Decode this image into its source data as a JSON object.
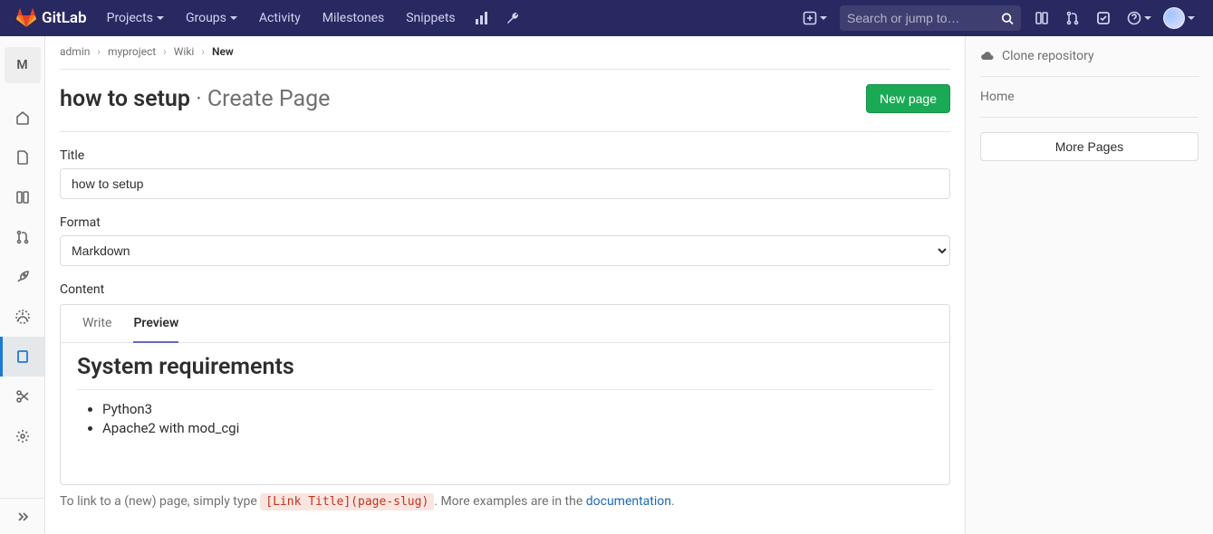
{
  "brand": "GitLab",
  "nav": {
    "projects": "Projects",
    "groups": "Groups",
    "activity": "Activity",
    "milestones": "Milestones",
    "snippets": "Snippets"
  },
  "search": {
    "placeholder": "Search or jump to…"
  },
  "sidenav": {
    "project_initial": "M"
  },
  "breadcrumbs": {
    "a": "admin",
    "b": "myproject",
    "c": "Wiki",
    "d": "New"
  },
  "header": {
    "title": "how to setup",
    "subtitle": " · Create Page",
    "new_page": "New page"
  },
  "form": {
    "title_label": "Title",
    "title_value": "how to setup",
    "format_label": "Format",
    "format_value": "Markdown",
    "content_label": "Content",
    "tab_write": "Write",
    "tab_preview": "Preview"
  },
  "preview": {
    "heading": "System requirements",
    "item1": "Python3",
    "item2": "Apache2 with mod_cgi"
  },
  "help": {
    "prefix": "To link to a (new) page, simply type ",
    "code": "[Link Title](page-slug)",
    "middle": ". More examples are in the ",
    "link": "documentation",
    "suffix": "."
  },
  "rightbar": {
    "clone": "Clone repository",
    "home": "Home",
    "more": "More Pages"
  }
}
